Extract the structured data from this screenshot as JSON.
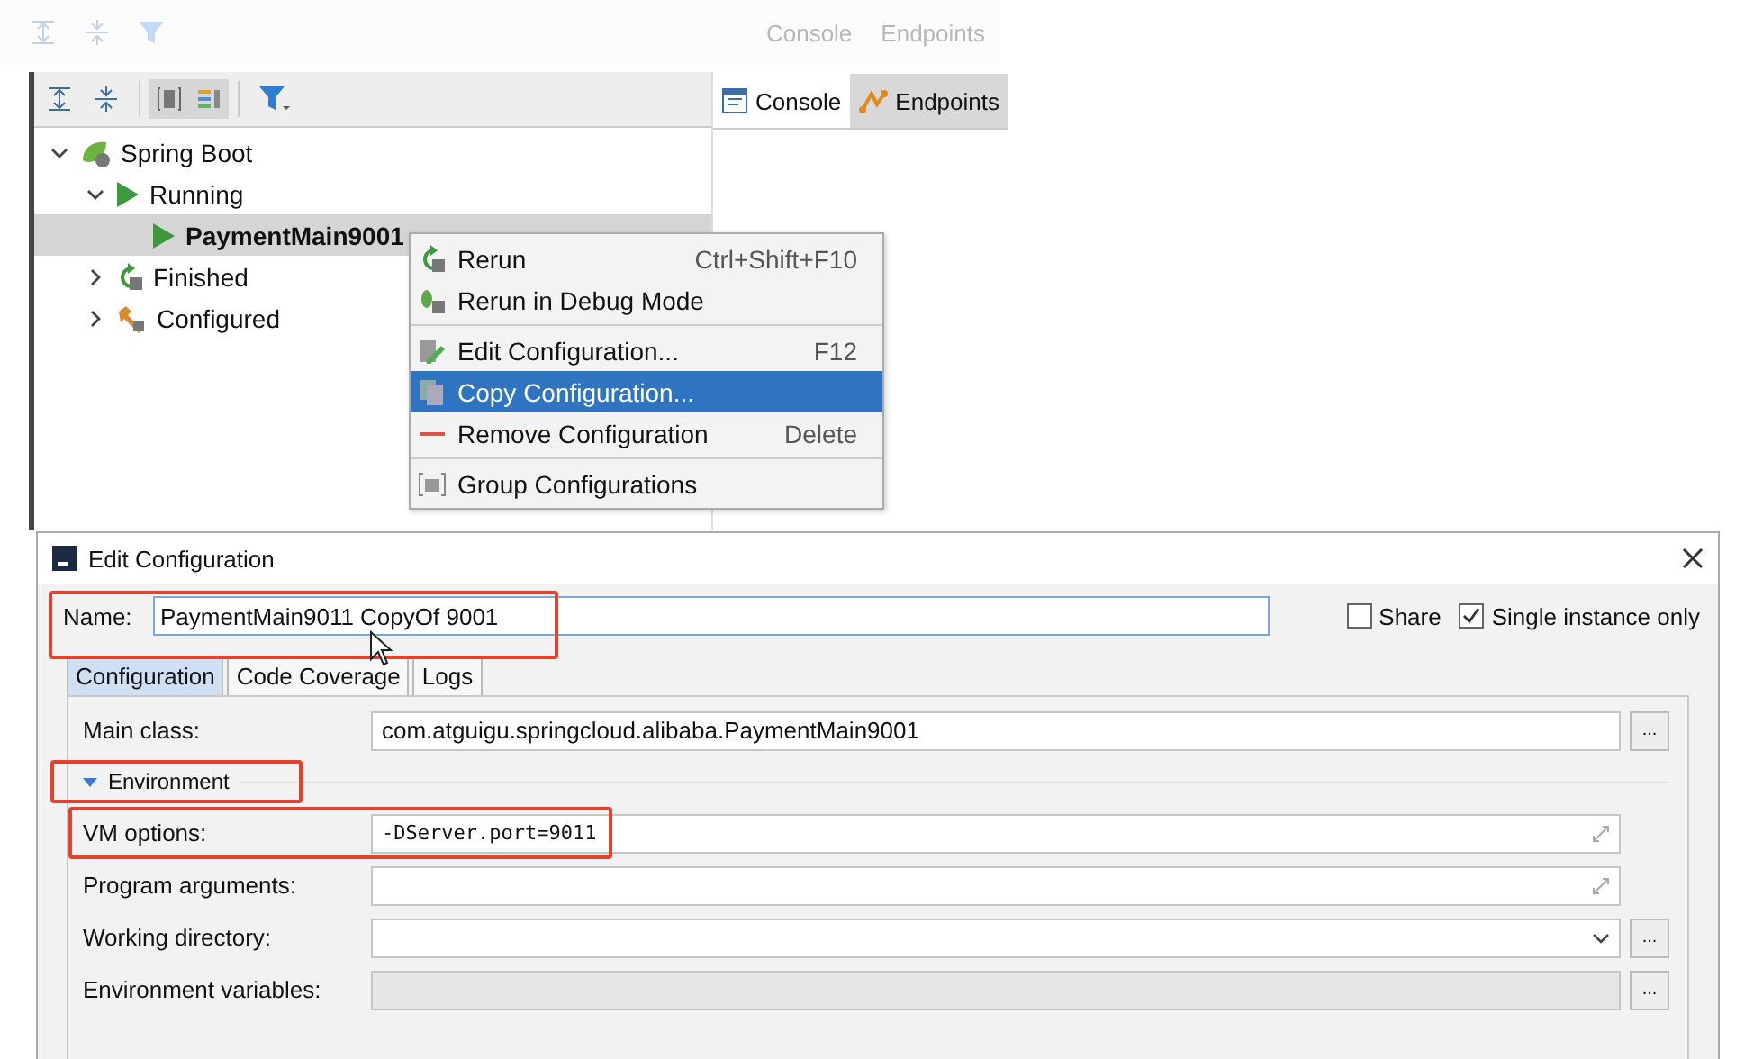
{
  "ghost_toolbar": {
    "tabs": [
      {
        "label": "Console"
      },
      {
        "label": "Endpoints"
      }
    ]
  },
  "run_panel": {
    "tabs": [
      {
        "label": "Console",
        "selected": true,
        "kind": "console"
      },
      {
        "label": "Endpoints",
        "selected": false,
        "kind": "endpoints"
      }
    ],
    "tree": [
      {
        "label": "Spring Boot",
        "kind": "spring",
        "expanded": true,
        "selected": false,
        "children": [
          {
            "label": "Running",
            "kind": "run",
            "expanded": true,
            "selected": false,
            "children": [
              {
                "label": "PaymentMain9001",
                "kind": "run",
                "selected": true
              }
            ]
          },
          {
            "label": "Finished",
            "kind": "rerun",
            "expanded": false,
            "selected": false
          },
          {
            "label": "Configured",
            "kind": "config",
            "expanded": false,
            "selected": false
          }
        ]
      }
    ]
  },
  "context_menu": [
    {
      "kind": "rerun",
      "label": "Rerun",
      "shortcut": "Ctrl+Shift+F10",
      "selected": false
    },
    {
      "kind": "debug",
      "label": "Rerun in Debug Mode",
      "selected": false
    },
    {
      "kind": "separator"
    },
    {
      "kind": "edit",
      "label": "Edit Configuration...",
      "shortcut": "F12",
      "selected": false
    },
    {
      "kind": "copy",
      "label": "Copy Configuration...",
      "selected": true
    },
    {
      "kind": "remove",
      "label": "Remove Configuration",
      "shortcut": "Delete",
      "selected": false
    },
    {
      "kind": "separator"
    },
    {
      "kind": "group",
      "label": "Group Configurations",
      "selected": false
    }
  ],
  "dialog": {
    "title": "Edit Configuration",
    "name_label": "Name:",
    "name_value": "PaymentMain9011 CopyOf 9001",
    "name_highlighted": true,
    "options": [
      {
        "label": "Share",
        "checked": false
      },
      {
        "label": "Single instance only",
        "checked": true
      }
    ],
    "tabs": [
      {
        "label": "Configuration",
        "selected": true
      },
      {
        "label": "Code Coverage",
        "selected": false
      },
      {
        "label": "Logs",
        "selected": false
      }
    ],
    "fields": [
      {
        "kind": "field",
        "label": "Main class:",
        "value": "com.atguigu.springcloud.alibaba.PaymentMain9001",
        "browse": "...",
        "highlighted": false,
        "disabled": false
      },
      {
        "kind": "section",
        "label": "Environment",
        "expanded": true,
        "highlighted": true
      },
      {
        "kind": "expandable",
        "label": "VM options:",
        "value": "-DServer.port=9011",
        "highlighted": true
      },
      {
        "kind": "expandable",
        "label": "Program arguments:",
        "highlighted": false
      },
      {
        "kind": "combo",
        "label": "Working directory:",
        "browse": "...",
        "highlighted": false
      },
      {
        "kind": "field",
        "label": "Environment variables:",
        "browse": "...",
        "highlighted": false,
        "disabled": true
      }
    ]
  }
}
